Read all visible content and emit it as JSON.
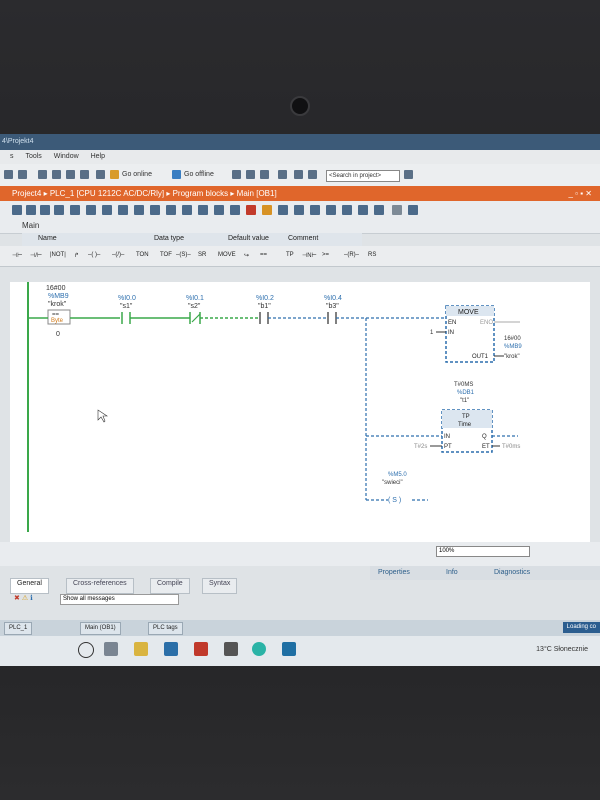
{
  "window": {
    "title": "4\\Projekt4"
  },
  "menu": {
    "items": [
      "s",
      "Tools",
      "Window",
      "Help"
    ]
  },
  "toolbar": {
    "go_online": "Go online",
    "go_offline": "Go offline",
    "search_placeholder": "<Search in project>"
  },
  "breadcrumb": {
    "items": [
      "Project4",
      "PLC_1 [CPU 1212C AC/DC/Rly]",
      "Program blocks",
      "Main [OB1]"
    ]
  },
  "block": {
    "name": "Main"
  },
  "interface_headers": {
    "name": "Name",
    "data_type": "Data type",
    "default_value": "Default value",
    "comment": "Comment"
  },
  "ladder_toolbar": {
    "items": [
      "TON",
      "TOF",
      "MOVE",
      "TP"
    ]
  },
  "network": {
    "left_label_top": "16#00",
    "left_addr": "%MB9",
    "left_tag": "\"krok\"",
    "left_type": "Byte",
    "left_value": "0",
    "contacts": [
      {
        "addr": "%I0.0",
        "tag": "\"s1\""
      },
      {
        "addr": "%I0.1",
        "tag": "\"s2\""
      },
      {
        "addr": "%I0.2",
        "tag": "\"b1\""
      },
      {
        "addr": "%I0.4",
        "tag": "\"b3\""
      }
    ],
    "move": {
      "title": "MOVE",
      "en": "EN",
      "eno": "ENO",
      "in": "IN",
      "in_value": "1",
      "out": "OUT1",
      "out_top": "16#00",
      "out_addr": "%MB9",
      "out_tag": "\"krok\""
    },
    "tp": {
      "db": "T#0MS",
      "db_addr": "%DB1",
      "db_tag": "\"t1\"",
      "title": "TP",
      "subtitle": "Time",
      "in": "IN",
      "q": "Q",
      "pt": "PT",
      "et": "ET",
      "pt_value": "T#2s",
      "et_value": "T#0ms"
    },
    "coil": {
      "addr": "%M5.0",
      "tag": "\"swieci\"",
      "symbol": "( S )"
    }
  },
  "status": {
    "zoom": "100%"
  },
  "properties_tabs": [
    "Properties",
    "Info",
    "Diagnostics"
  ],
  "bottom_tabs": [
    "General",
    "Cross-references",
    "Compile",
    "Syntax"
  ],
  "messages": {
    "filter": "Show all messages"
  },
  "taskbar": {
    "items": [
      "PLC_1",
      "Main (OB1)",
      "PLC tags"
    ],
    "loading": "Loading co"
  },
  "weather": {
    "text": "13°C  Słonecznie"
  },
  "colors": {
    "breadcrumb": "#e0662b",
    "wire": "#3aa84a",
    "block_border": "#2d6fae"
  }
}
